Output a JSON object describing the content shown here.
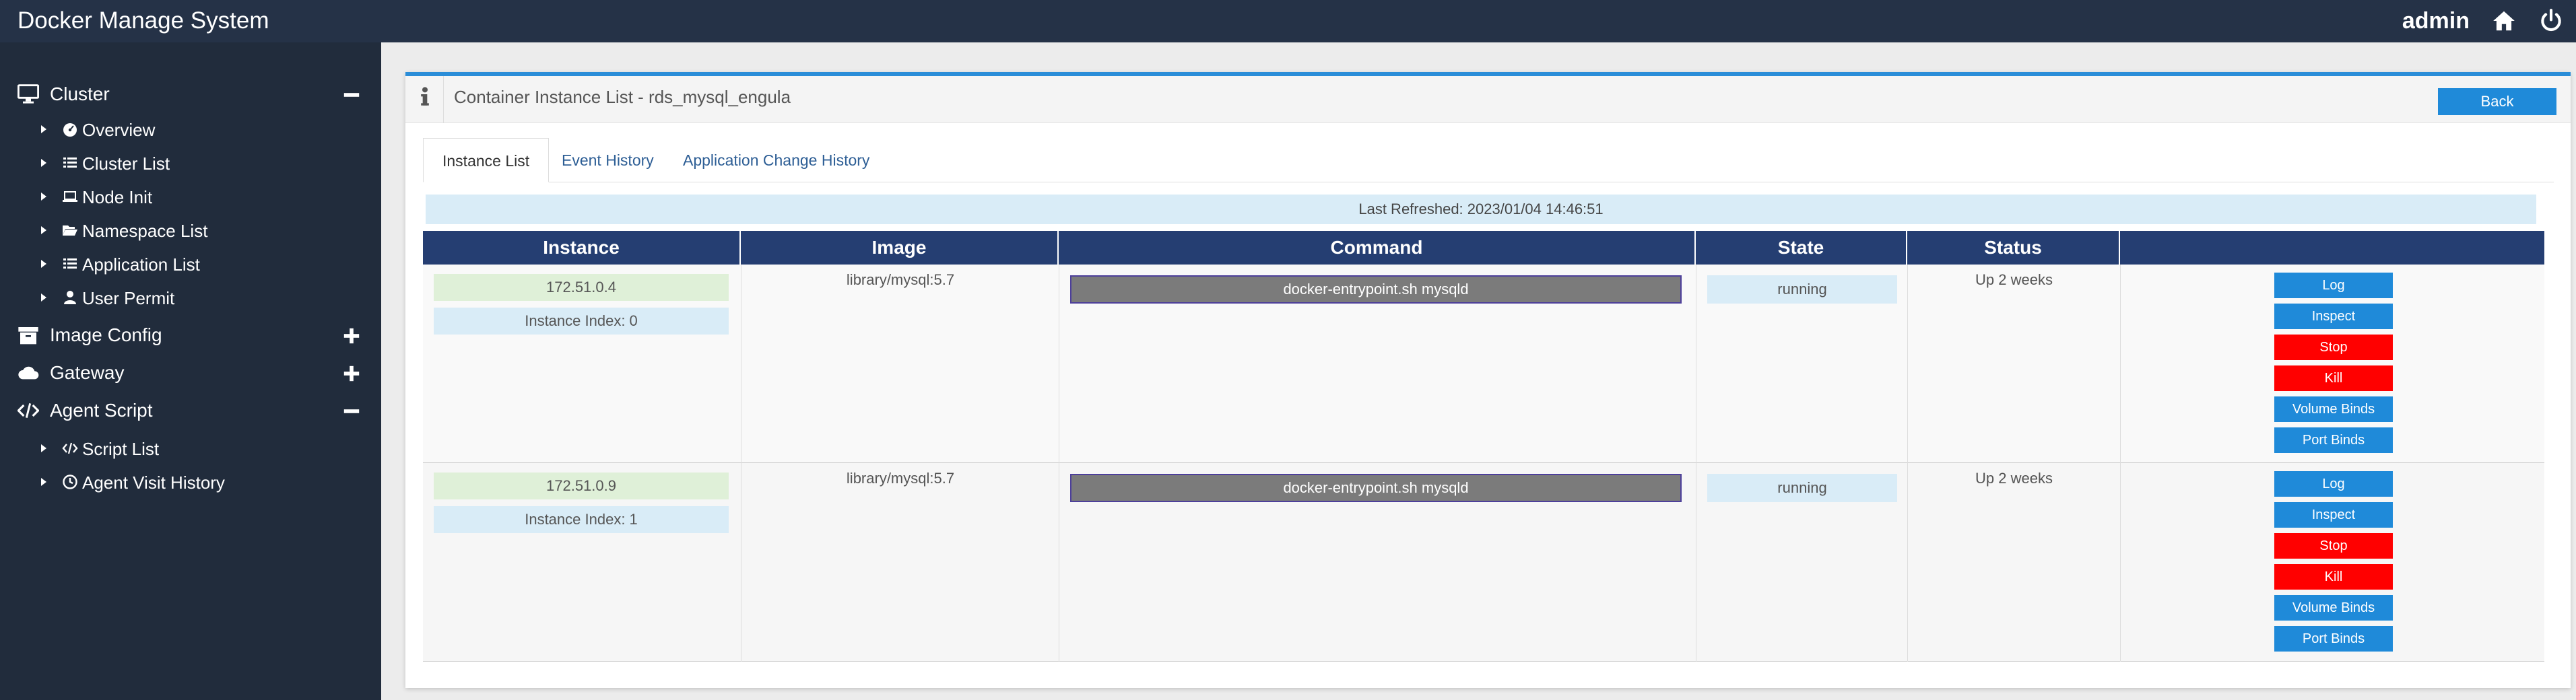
{
  "app": {
    "title": "Docker Manage System",
    "user": "admin"
  },
  "sidebar": {
    "cluster": {
      "label": "Cluster",
      "toggle": "minus"
    },
    "cluster_items": [
      {
        "label": "Overview",
        "icon": "dashboard-icon"
      },
      {
        "label": "Cluster List",
        "icon": "list-icon"
      },
      {
        "label": "Node Init",
        "icon": "laptop-icon"
      },
      {
        "label": "Namespace List",
        "icon": "folder-open-icon"
      },
      {
        "label": "Application List",
        "icon": "list-icon"
      },
      {
        "label": "User Permit",
        "icon": "user-icon"
      }
    ],
    "image_config": {
      "label": "Image Config",
      "toggle": "plus"
    },
    "gateway": {
      "label": "Gateway",
      "toggle": "plus"
    },
    "agent_script": {
      "label": "Agent Script",
      "toggle": "minus"
    },
    "agent_items": [
      {
        "label": "Script List",
        "icon": "code-icon"
      },
      {
        "label": "Agent Visit History",
        "icon": "clock-icon"
      }
    ]
  },
  "panel": {
    "title": "Container Instance List - rds_mysql_engula",
    "back_label": "Back",
    "tabs": [
      "Instance List",
      "Event History",
      "Application Change History"
    ],
    "active_tab": 0,
    "last_refreshed": "Last Refreshed: 2023/01/04 14:46:51"
  },
  "table": {
    "headers": [
      "Instance",
      "Image",
      "Command",
      "State",
      "Status",
      ""
    ],
    "rows": [
      {
        "ip": "172.51.0.4",
        "index": "Instance Index: 0",
        "image": "library/mysql:5.7",
        "command": "docker-entrypoint.sh mysqld",
        "state": "running",
        "status": "Up 2 weeks"
      },
      {
        "ip": "172.51.0.9",
        "index": "Instance Index: 1",
        "image": "library/mysql:5.7",
        "command": "docker-entrypoint.sh mysqld",
        "state": "running",
        "status": "Up 2 weeks"
      }
    ],
    "actions": [
      "Log",
      "Inspect",
      "Stop",
      "Kill",
      "Volume Binds",
      "Port Binds"
    ]
  },
  "colors": {
    "topbar": "#253247",
    "sidebar": "#212c3c",
    "accent": "#1f8ad9",
    "danger": "#ff0000",
    "table_header": "#253e72"
  }
}
